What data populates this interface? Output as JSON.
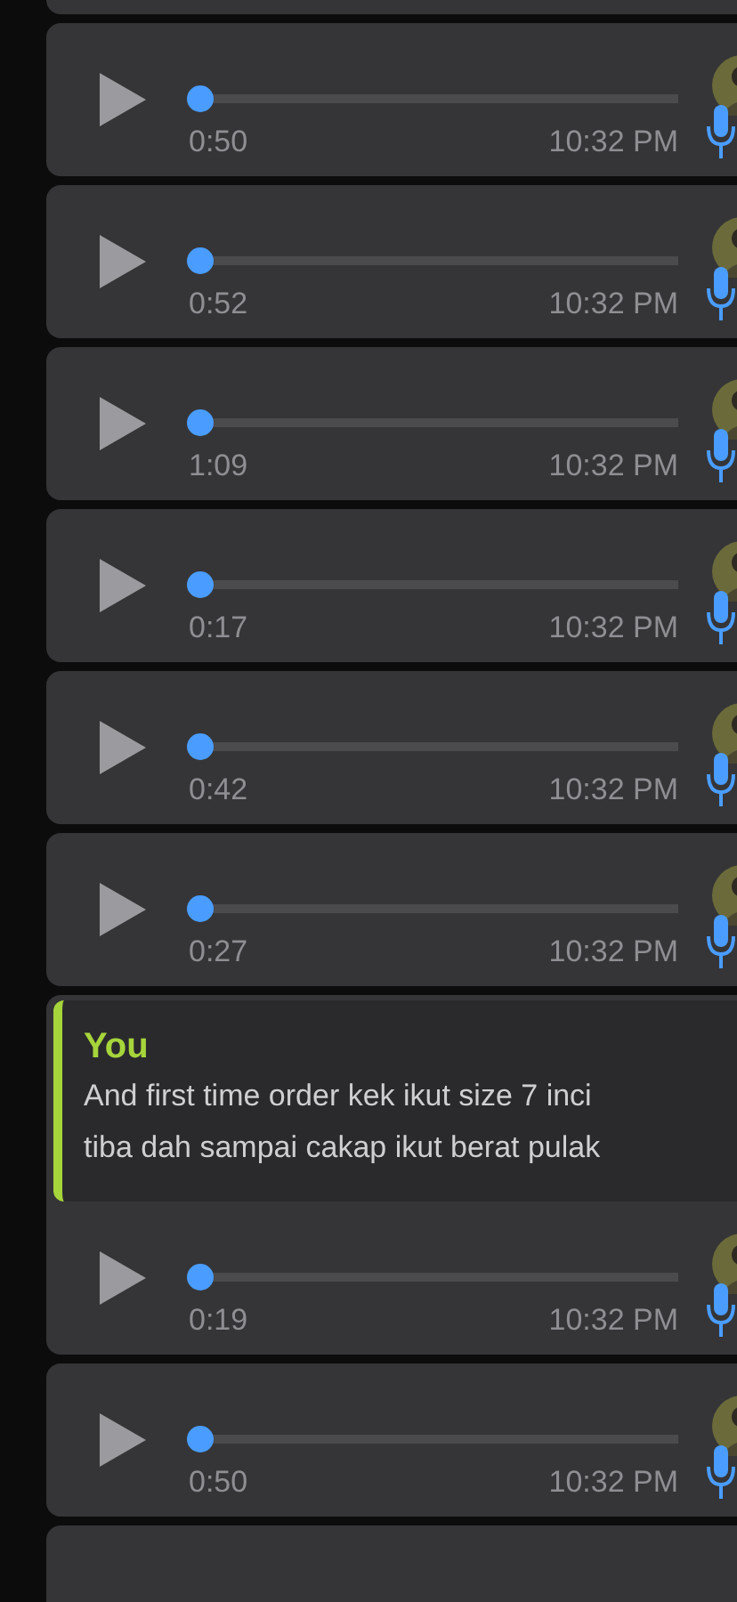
{
  "messages": [
    {
      "kind": "voice",
      "duration": "0:50",
      "time": "10:32 PM",
      "level": 0
    },
    {
      "kind": "voice",
      "duration": "0:52",
      "time": "10:32 PM",
      "level": 0
    },
    {
      "kind": "voice",
      "duration": "1:09",
      "time": "10:32 PM",
      "level": 0
    },
    {
      "kind": "voice",
      "duration": "0:17",
      "time": "10:32 PM",
      "level": 0
    },
    {
      "kind": "voice",
      "duration": "0:42",
      "time": "10:32 PM",
      "level": 0
    },
    {
      "kind": "voice",
      "duration": "0:27",
      "time": "10:32 PM",
      "level": 0
    },
    {
      "kind": "reply",
      "quote": {
        "author": "You",
        "lines": [
          "And first time order kek ikut size 7 inci",
          "tiba dah sampai cakap ikut berat pulak"
        ]
      },
      "duration": "0:19",
      "time": "10:32 PM",
      "level": 0
    },
    {
      "kind": "voice",
      "duration": "0:50",
      "time": "10:32 PM",
      "level": 0
    }
  ]
}
